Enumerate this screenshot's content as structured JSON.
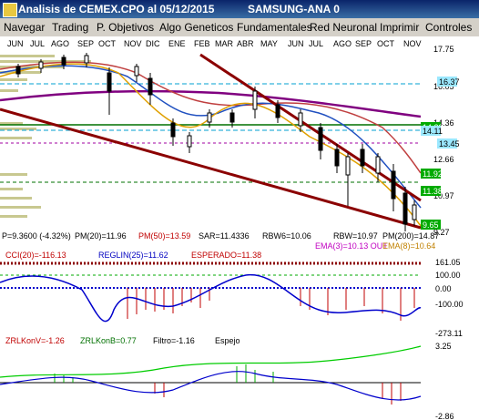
{
  "window": {
    "title": "Analisis de CEMEX.CPO al 05/12/2015",
    "right_title": "SAMSUNG-ANA 0"
  },
  "menu": [
    "Navegar",
    "Trading",
    "P. Objetivos",
    "Algo Geneticos",
    "Fundamentales",
    "Red Neuronal",
    "Imprimir",
    "Controles"
  ],
  "months": [
    "JUN",
    "JUL",
    "AGO",
    "SEP",
    "OCT",
    "NOV",
    "DIC",
    "ENE",
    "FEB",
    "MAR",
    "ABR",
    "MAY",
    "JUN",
    "JUL",
    "AGO",
    "SEP",
    "OCT",
    "NOV"
  ],
  "price_axis": [
    "17.75",
    "16.05",
    "14.36",
    "12.66",
    "10.97",
    "9.27"
  ],
  "price_tags": [
    {
      "text": "16.37",
      "bg": "#9be8ff"
    },
    {
      "text": "14.23",
      "bg": "#00aa00"
    },
    {
      "text": "14.11",
      "bg": "#9be8ff"
    },
    {
      "text": "13.45",
      "bg": "#9be8ff"
    },
    {
      "text": "11.92",
      "bg": "#00aa00"
    },
    {
      "text": "11.38",
      "bg": "#00aa00"
    },
    {
      "text": "9.65",
      "bg": "#00aa00"
    }
  ],
  "info": {
    "price": "P=9.3600 (-4.32%)",
    "pm20": "PM(20)=11.96",
    "pm50": "PM(50)=13.59",
    "sar": "SAR=11.4336",
    "rbw6": "RBW6=10.06",
    "rbw": "RBW=10.97",
    "pm200": "PM(200)=14.87",
    "ema3": "EMA(3)=10.13 OUT",
    "ema8": "EMA(8)=10.64"
  },
  "cci": {
    "label": "CCI(20)=-116.13",
    "reglin": "REGLIN(25)=11.62",
    "esperado": "ESPERADO=11.38",
    "axis": [
      "161.05",
      "100.00",
      "0.00",
      "-100.00",
      "-273.11"
    ]
  },
  "zrl": {
    "konv": "ZRLKonV=-1.26",
    "konb": "ZRLKonB=0.77",
    "filtro": "Filtro=-1.16",
    "espejo": "Espejo",
    "axis": [
      "3.25",
      "-2.86"
    ]
  },
  "colors": {
    "title_bg": "#0a246a",
    "trend": "#8b0000",
    "cci_line": "#0000cc",
    "zrl_line": "#00cc00"
  }
}
